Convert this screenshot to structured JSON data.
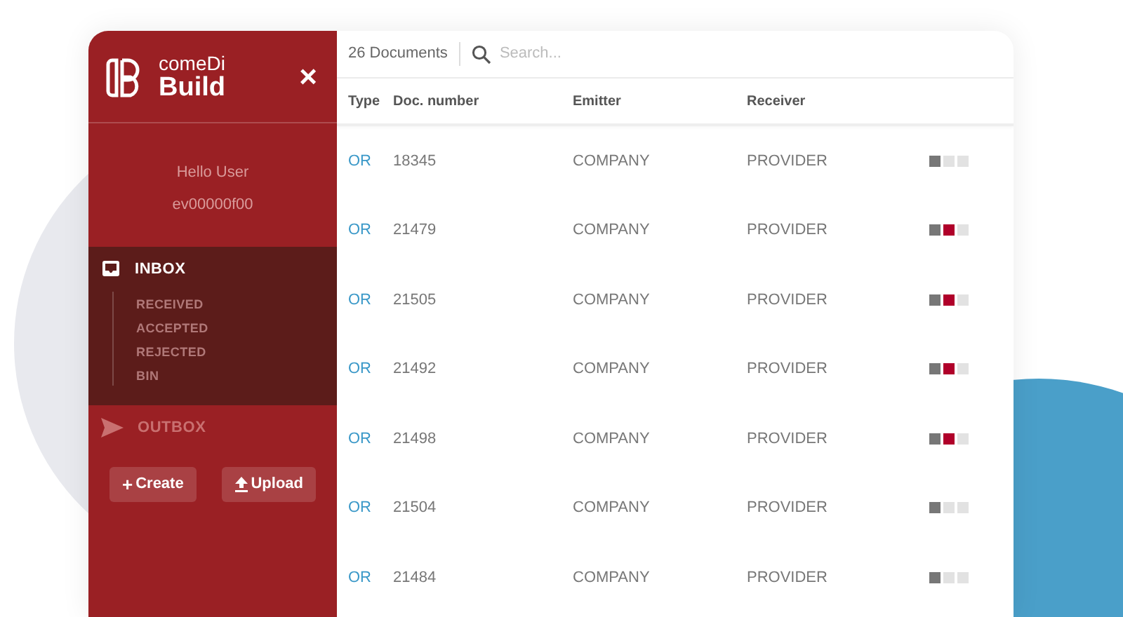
{
  "brand": {
    "line_1": "comeDi",
    "line_2": "Build"
  },
  "close_icon": "×",
  "user": {
    "greeting": "Hello User",
    "id": "ev00000f00"
  },
  "nav": [
    {
      "kind": "inbox",
      "label": "INBOX",
      "selected": true,
      "children": [
        {
          "label": "RECEIVED"
        },
        {
          "label": "ACCEPTED"
        },
        {
          "label": "REJECTED"
        },
        {
          "label": "BIN"
        }
      ]
    },
    {
      "kind": "outbox",
      "label": "OUTBOX",
      "selected": false
    }
  ],
  "actions": [
    {
      "kind": "create",
      "label": "Create",
      "symbol": "+"
    },
    {
      "kind": "upload",
      "label": "Upload"
    }
  ],
  "toolbar": {
    "count": "26 Documents",
    "search": {
      "placeholder": "Search..."
    }
  },
  "table": {
    "columns": [
      "Type",
      "Doc. number",
      "Emitter",
      "Receiver"
    ],
    "rows": [
      {
        "type": "OR",
        "number": "18345",
        "emitter": "COMPANY",
        "receiver": "PROVIDER",
        "steps": [
          {
            "color": "#777777"
          },
          {
            "color": "#e2e2e2"
          },
          {
            "color": "#e2e2e2"
          }
        ]
      },
      {
        "type": "OR",
        "number": "21479",
        "emitter": "COMPANY",
        "receiver": "PROVIDER",
        "steps": [
          {
            "color": "#777777"
          },
          {
            "color": "#b0002a"
          },
          {
            "color": "#e2e2e2"
          }
        ]
      },
      {
        "type": "OR",
        "number": "21505",
        "emitter": "COMPANY",
        "receiver": "PROVIDER",
        "steps": [
          {
            "color": "#777777"
          },
          {
            "color": "#b0002a"
          },
          {
            "color": "#e2e2e2"
          }
        ]
      },
      {
        "type": "OR",
        "number": "21492",
        "emitter": "COMPANY",
        "receiver": "PROVIDER",
        "steps": [
          {
            "color": "#777777"
          },
          {
            "color": "#b0002a"
          },
          {
            "color": "#e2e2e2"
          }
        ]
      },
      {
        "type": "OR",
        "number": "21498",
        "emitter": "COMPANY",
        "receiver": "PROVIDER",
        "steps": [
          {
            "color": "#777777"
          },
          {
            "color": "#b0002a"
          },
          {
            "color": "#e2e2e2"
          }
        ]
      },
      {
        "type": "OR",
        "number": "21504",
        "emitter": "COMPANY",
        "receiver": "PROVIDER",
        "steps": [
          {
            "color": "#777777"
          },
          {
            "color": "#e2e2e2"
          },
          {
            "color": "#e2e2e2"
          }
        ]
      },
      {
        "type": "OR",
        "number": "21484",
        "emitter": "COMPANY",
        "receiver": "PROVIDER",
        "steps": [
          {
            "color": "#777777"
          },
          {
            "color": "#e2e2e2"
          },
          {
            "color": "#e2e2e2"
          }
        ]
      }
    ]
  }
}
